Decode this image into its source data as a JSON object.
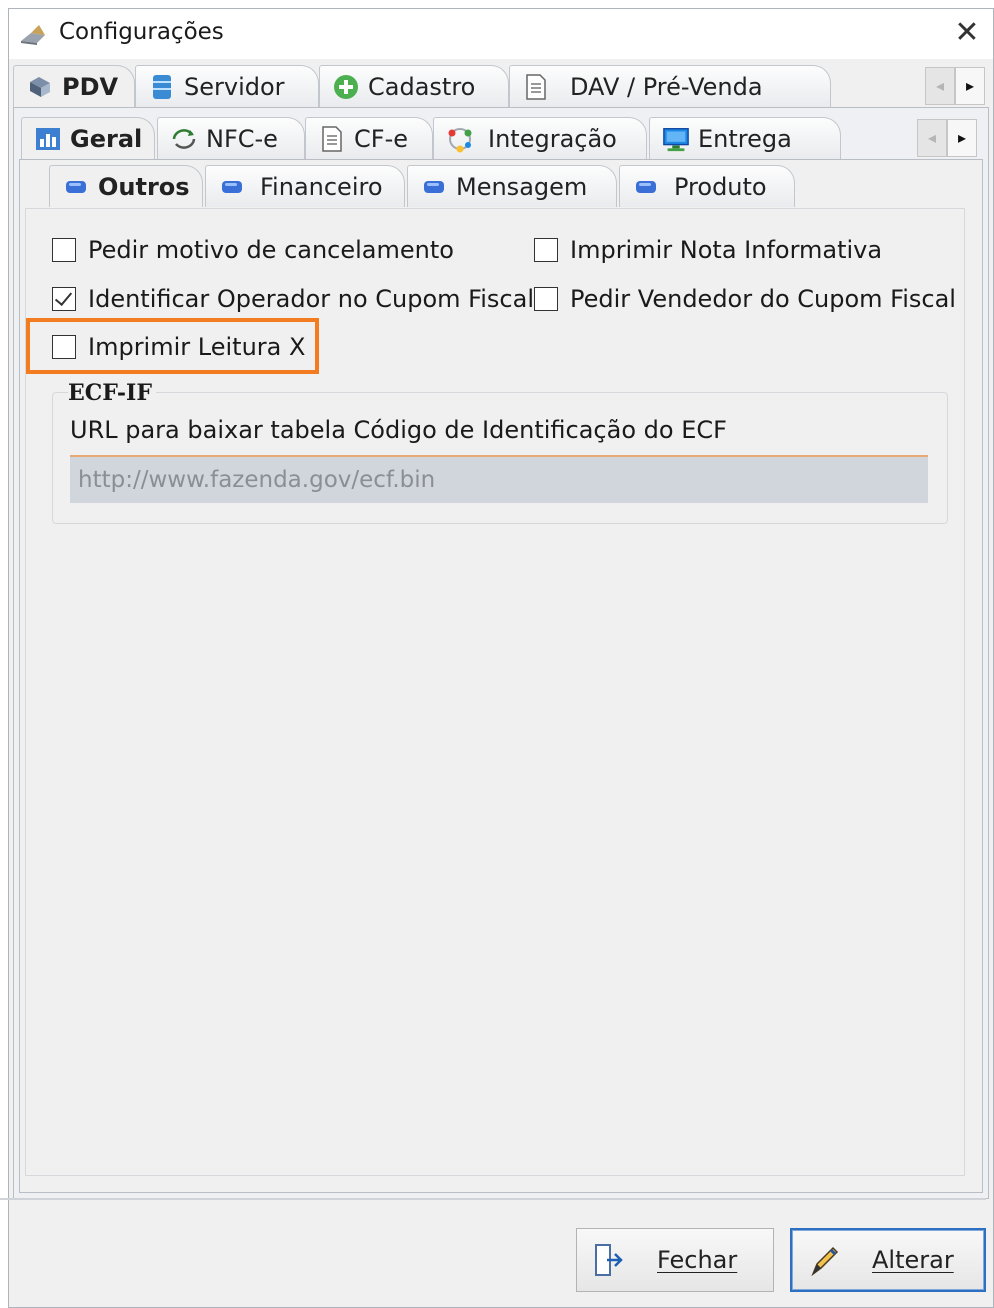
{
  "window": {
    "title": "Configurações",
    "close_label": "✕"
  },
  "tabs_level1": [
    {
      "label": "PDV",
      "icon": "pdv-icon",
      "active": true
    },
    {
      "label": "Servidor",
      "icon": "database-icon",
      "active": false
    },
    {
      "label": "Cadastro",
      "icon": "add-icon",
      "active": false
    },
    {
      "label": "DAV / Pré-Venda",
      "icon": "document-icon",
      "active": false
    }
  ],
  "tabs_level2": [
    {
      "label": "Geral",
      "icon": "chart-icon",
      "active": true
    },
    {
      "label": "NFC-e",
      "icon": "sync-icon",
      "active": false
    },
    {
      "label": "CF-e",
      "icon": "document-icon",
      "active": false
    },
    {
      "label": "Integração",
      "icon": "integration-icon",
      "active": false
    },
    {
      "label": "Entrega",
      "icon": "monitor-icon",
      "active": false
    }
  ],
  "tabs_level3": [
    {
      "label": "Outros",
      "icon": "blue-dot-icon",
      "active": true
    },
    {
      "label": "Financeiro",
      "icon": "blue-dot-icon",
      "active": false
    },
    {
      "label": "Mensagem",
      "icon": "blue-dot-icon",
      "active": false
    },
    {
      "label": "Produto",
      "icon": "blue-dot-icon",
      "active": false
    }
  ],
  "scroll": {
    "left": "◂",
    "right": "▸"
  },
  "options": [
    {
      "label": "Pedir motivo de cancelamento",
      "checked": false
    },
    {
      "label": "Imprimir Nota Informativa",
      "checked": false
    },
    {
      "label": "Identificar Operador no Cupom Fiscal",
      "checked": true
    },
    {
      "label": "Pedir Vendedor do Cupom Fiscal",
      "checked": false
    },
    {
      "label": "Imprimir Leitura X",
      "checked": false
    }
  ],
  "ecf_group": {
    "title": "ECF-IF",
    "url_label": "URL para baixar tabela Código de Identificação do ECF",
    "url_value": "http://www.fazenda.gov/ecf.bin"
  },
  "buttons": {
    "close": {
      "label": "Fechar",
      "icon": "exit-icon"
    },
    "save": {
      "label": "Alterar",
      "icon": "edit-icon"
    }
  },
  "colors": {
    "highlight": "#f47c20",
    "primary_border": "#2f6fbf",
    "blue_tab_icon": "#3a6fd8"
  }
}
